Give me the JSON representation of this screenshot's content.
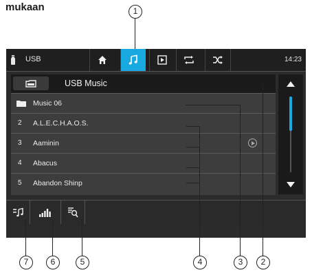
{
  "page": {
    "heading": "mukaan"
  },
  "status_bar": {
    "source_label": "USB",
    "time": "14:23",
    "tabs": [
      {
        "icon": "home-icon",
        "active": false
      },
      {
        "icon": "music-note-icon",
        "active": true
      },
      {
        "icon": "video-icon",
        "active": false
      },
      {
        "icon": "repeat-icon",
        "active": false
      },
      {
        "icon": "shuffle-icon",
        "active": false
      }
    ],
    "active_color": "#18a9e0"
  },
  "browser": {
    "title": "USB Music",
    "items": [
      {
        "number": "",
        "label": "Music 06",
        "type": "folder"
      },
      {
        "number": "2",
        "label": "A.L.E.C.H.A.O.S.",
        "type": "track"
      },
      {
        "number": "3",
        "label": "Aaminin",
        "type": "track"
      },
      {
        "number": "4",
        "label": "Abacus",
        "type": "track"
      },
      {
        "number": "5",
        "label": "Abandon Shinp",
        "type": "track"
      }
    ]
  },
  "bottom_bar": {
    "buttons": [
      "music-list-icon",
      "equalizer-icon",
      "search-list-icon"
    ]
  },
  "callouts": {
    "c1": "1",
    "c2": "2",
    "c3": "3",
    "c4": "4",
    "c5": "5",
    "c6": "6",
    "c7": "7"
  }
}
